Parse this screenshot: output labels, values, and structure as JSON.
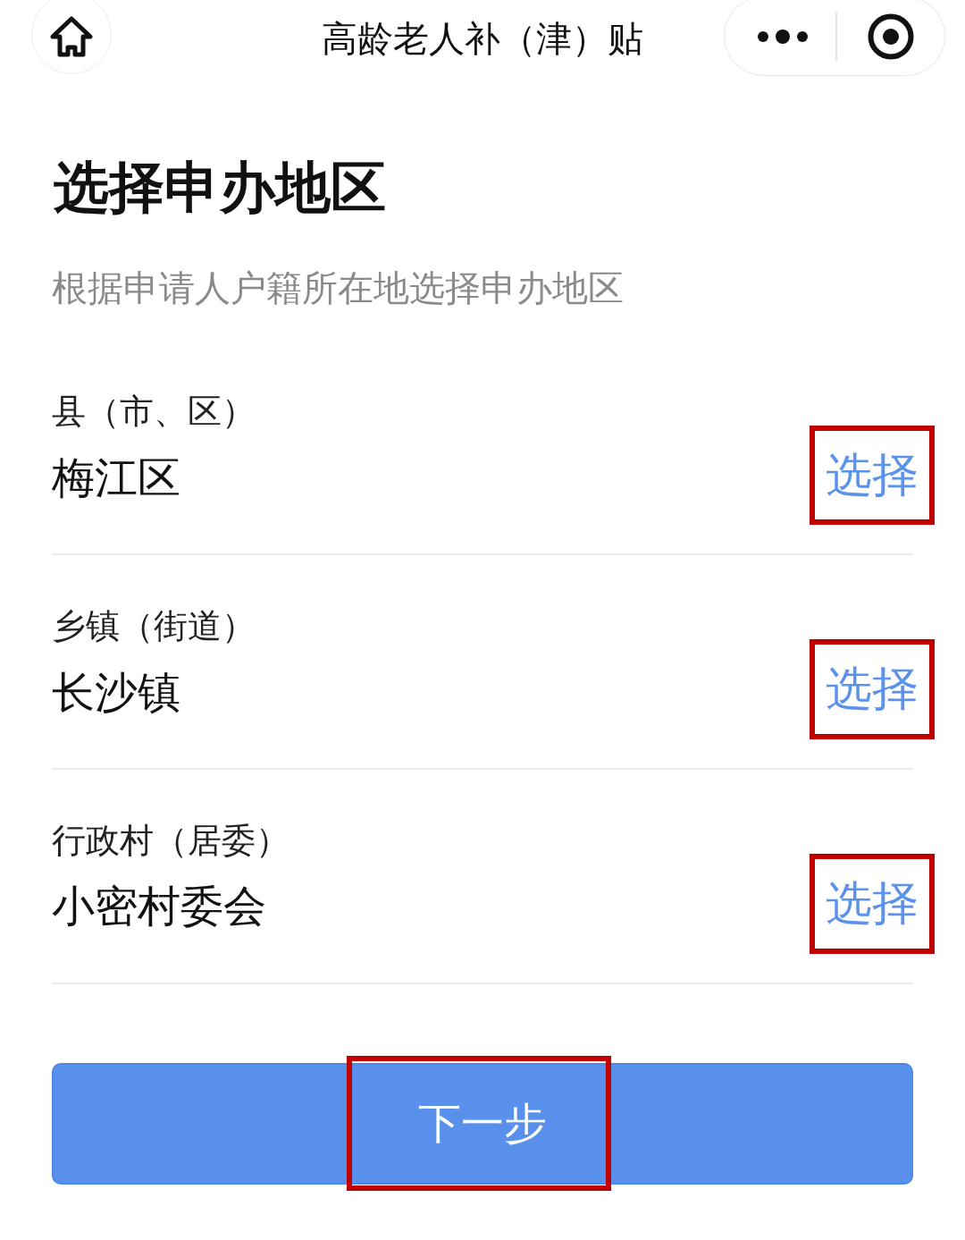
{
  "nav_bar": {
    "title": "高龄老人补（津）贴"
  },
  "heading": "选择申办地区",
  "subtitle": "根据申请人户籍所在地选择申办地区",
  "fields": [
    {
      "label": "县（市、区）",
      "value": "梅江区",
      "action": "选择",
      "highlighted": true
    },
    {
      "label": "乡镇（街道）",
      "value": "长沙镇",
      "action": "选择",
      "highlighted": true
    },
    {
      "label": "行政村（居委）",
      "value": "小密村委会",
      "action": "选择",
      "highlighted": true
    }
  ],
  "next_button": {
    "label": "下一步",
    "highlighted": true
  }
}
